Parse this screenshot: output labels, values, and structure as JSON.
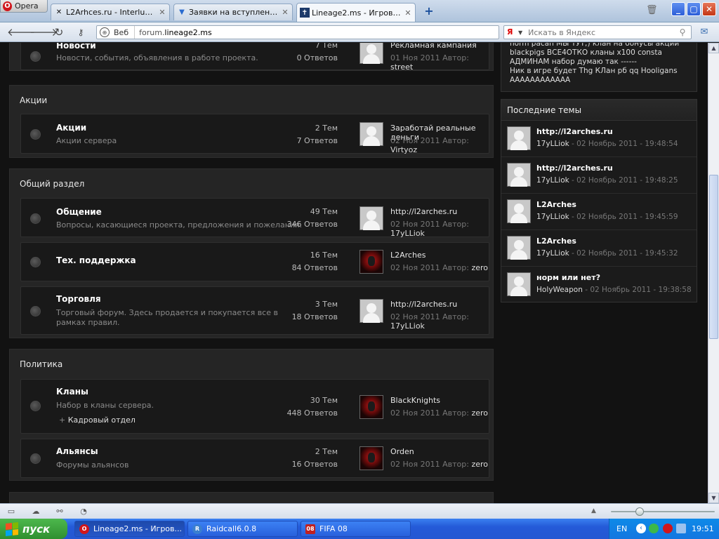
{
  "browser": {
    "menu_label": "Opera",
    "tabs": [
      {
        "title": "L2Arhces.ru - Interlude ...",
        "icon": "tools-icon"
      },
      {
        "title": "Заявки на вступление -...",
        "icon": "forum-icon"
      },
      {
        "title": "Lineage2.ms - Игровое с...",
        "icon": "site-icon",
        "active": true
      }
    ],
    "address": {
      "scheme_label": "Веб",
      "url_prefix": "forum.",
      "url_domain": "lineage2.ms"
    },
    "search": {
      "placeholder": "Искать в Яндекс",
      "engine_logo": "Я"
    }
  },
  "categories": [
    {
      "title": "",
      "forums": [
        {
          "name": "Новости",
          "desc": "Новости, события, объявления в работе проекта.",
          "topics": "7 Тем",
          "posts": "0 Ответов",
          "avatar": "default",
          "last_title": "Рекламная кампания",
          "last_date": "01 Ноя 2011",
          "last_author_label": "Автор:",
          "last_author": "street"
        }
      ]
    },
    {
      "title": "Акции",
      "forums": [
        {
          "name": "Акции",
          "desc": "Акции сервера",
          "topics": "2 Тем",
          "posts": "7 Ответов",
          "avatar": "default",
          "last_title": "Заработай реальные деньги",
          "last_date": "02 Ноя 2011",
          "last_author_label": "Автор:",
          "last_author": "Virtyoz"
        }
      ]
    },
    {
      "title": "Общий раздел",
      "forums": [
        {
          "name": "Общение",
          "desc": "Вопросы, касающиеся проекта, предложения и пожелания.",
          "topics": "49 Тем",
          "posts": "346 Ответов",
          "avatar": "default",
          "last_title": "http://l2arches.ru",
          "last_date": "02 Ноя 2011",
          "last_author_label": "Автор:",
          "last_author": "17yLLiok"
        },
        {
          "name": "Тех. поддержка",
          "desc": "",
          "topics": "16 Тем",
          "posts": "84 Ответов",
          "avatar": "red",
          "last_title": "L2Arches",
          "last_date": "02 Ноя 2011",
          "last_author_label": "Автор:",
          "last_author": "zero"
        },
        {
          "name": "Торговля",
          "desc": "Торговый форум. Здесь продается и покупается все в рамках правил.",
          "topics": "3 Тем",
          "posts": "18 Ответов",
          "avatar": "default",
          "last_title": "http://l2arches.ru",
          "last_date": "02 Ноя 2011",
          "last_author_label": "Автор:",
          "last_author": "17yLLiok"
        }
      ]
    },
    {
      "title": "Политика",
      "forums": [
        {
          "name": "Кланы",
          "desc": "Набор в кланы сервера.",
          "subforum": "Кадровый отдел",
          "topics": "30 Тем",
          "posts": "448 Ответов",
          "avatar": "red",
          "last_title": "BlackKnights",
          "last_date": "02 Ноя 2011",
          "last_author_label": "Автор:",
          "last_author": "zero"
        },
        {
          "name": "Альянсы",
          "desc": "Форумы альянсов",
          "topics": "2 Тем",
          "posts": "16 Ответов",
          "avatar": "red",
          "last_title": "Orden",
          "last_date": "02 Ноя 2011",
          "last_author_label": "Автор:",
          "last_author": "zero"
        }
      ]
    }
  ],
  "sidebar": {
    "tag_lines": [
      "norm pacan   МЫ ТУТ;)   клан на   бонусы акции",
      "blackpigs   ВСЕ4ОТКО   кланы   x100   consta",
      "АДМИНАМ   набор   думаю так   ------",
      "Ник в игре будет Thg   КЛан   рб   qq   Hooligans",
      "АААААААААААА"
    ],
    "recent_title": "Последние темы",
    "recent": [
      {
        "title": "http://l2arches.ru",
        "author": "17yLLiok",
        "date": " - 02 Ноябрь 2011 - 19:48:54"
      },
      {
        "title": "http://l2arches.ru",
        "author": "17yLLiok",
        "date": " - 02 Ноябрь 2011 - 19:48:25"
      },
      {
        "title": "L2Arches",
        "author": "17yLLiok",
        "date": " - 02 Ноябрь 2011 - 19:45:59"
      },
      {
        "title": "L2Arches",
        "author": "17yLLiok",
        "date": " - 02 Ноябрь 2011 - 19:45:32"
      },
      {
        "title": "норм или нет?",
        "author": "HolyWeapon",
        "date": " - 02 Ноябрь 2011 - 19:38:58"
      }
    ]
  },
  "taskbar": {
    "start_label": "пуск",
    "items": [
      {
        "title": "Lineage2.ms - Игров...",
        "icon_color": "#d0161c",
        "active": true
      },
      {
        "title": "Raidcall6.0.8",
        "icon_color": "#3a7fd0"
      },
      {
        "title": "FIFA 08",
        "icon_color": "#c02020",
        "icon_text": "08"
      }
    ],
    "lang": "EN",
    "clock": "19:51"
  },
  "colors": {
    "brand_opera": "#d0161c",
    "xp_start": "#3c9a3c",
    "xp_taskbar": "#245ad8"
  }
}
